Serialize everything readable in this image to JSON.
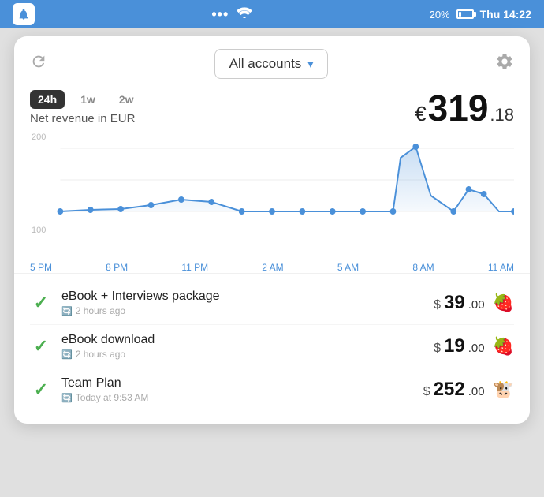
{
  "statusBar": {
    "dots": "•••",
    "wifi": "📶",
    "battery_pct": "20%",
    "time": "Thu 14:22"
  },
  "header": {
    "refresh_title": "Refresh",
    "account_label": "All accounts",
    "dropdown_arrow": "▾",
    "settings_title": "Settings"
  },
  "timeFilters": [
    {
      "label": "24h",
      "active": true
    },
    {
      "label": "1w",
      "active": false
    },
    {
      "label": "2w",
      "active": false
    }
  ],
  "stats": {
    "net_revenue_label": "Net revenue in EUR",
    "currency_symbol": "€",
    "amount_main": "319",
    "amount_cents": ".18"
  },
  "chart": {
    "y_labels": [
      "200",
      "100"
    ],
    "x_labels": [
      "5 PM",
      "8 PM",
      "11 PM",
      "2 AM",
      "5 AM",
      "8 AM",
      "11 AM"
    ]
  },
  "transactions": [
    {
      "name": "eBook + Interviews package",
      "time": "2 hours ago",
      "currency": "$",
      "amount_main": "39",
      "amount_cents": ".00",
      "emoji": "🍓"
    },
    {
      "name": "eBook download",
      "time": "2 hours ago",
      "currency": "$",
      "amount_main": "19",
      "amount_cents": ".00",
      "emoji": "🍓"
    },
    {
      "name": "Team Plan",
      "time": "Today at 9:53 AM",
      "currency": "$",
      "amount_main": "252",
      "amount_cents": ".00",
      "emoji": "🐮"
    }
  ]
}
